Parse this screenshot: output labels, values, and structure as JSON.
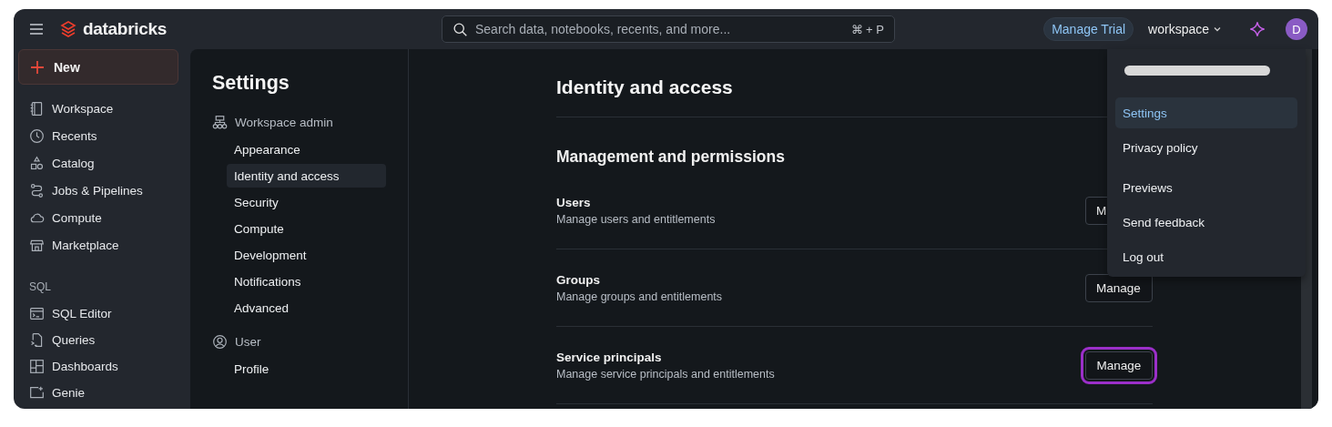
{
  "topbar": {
    "brand": "databricks",
    "search": {
      "placeholder": "Search data, notebooks, recents, and more...",
      "shortcut": "⌘ + P"
    },
    "trial_button": "Manage Trial",
    "workspace": "workspace",
    "avatar": "D"
  },
  "sidebar": {
    "new_button": "New",
    "items": [
      {
        "label": "Workspace"
      },
      {
        "label": "Recents"
      },
      {
        "label": "Catalog"
      },
      {
        "label": "Jobs & Pipelines"
      },
      {
        "label": "Compute"
      },
      {
        "label": "Marketplace"
      }
    ],
    "sections": [
      {
        "title": "SQL",
        "items": [
          {
            "label": "SQL Editor"
          },
          {
            "label": "Queries"
          },
          {
            "label": "Dashboards"
          },
          {
            "label": "Genie"
          }
        ]
      }
    ]
  },
  "settings_nav": {
    "title": "Settings",
    "groups": [
      {
        "title": "Workspace admin",
        "items": [
          {
            "label": "Appearance",
            "selected": false
          },
          {
            "label": "Identity and access",
            "selected": true
          },
          {
            "label": "Security",
            "selected": false
          },
          {
            "label": "Compute",
            "selected": false
          },
          {
            "label": "Development",
            "selected": false
          },
          {
            "label": "Notifications",
            "selected": false
          },
          {
            "label": "Advanced",
            "selected": false
          }
        ]
      },
      {
        "title": "User",
        "items": [
          {
            "label": "Profile",
            "selected": false
          }
        ]
      }
    ]
  },
  "content": {
    "title": "Identity and access",
    "section": "Management and permissions",
    "rows": [
      {
        "title": "Users",
        "description": "Manage users and entitlements",
        "button": "M",
        "highlighted": false
      },
      {
        "title": "Groups",
        "description": "Manage groups and entitlements",
        "button": "Manage",
        "highlighted": false
      },
      {
        "title": "Service principals",
        "description": "Manage service principals and entitlements",
        "button": "Manage",
        "highlighted": true
      }
    ]
  },
  "user_menu": {
    "items": [
      {
        "label": "Settings",
        "selected": true
      },
      {
        "label": "Privacy policy",
        "selected": false
      },
      {
        "label": "Previews",
        "selected": false
      },
      {
        "label": "Send feedback",
        "selected": false
      },
      {
        "label": "Log out",
        "selected": false
      }
    ]
  }
}
